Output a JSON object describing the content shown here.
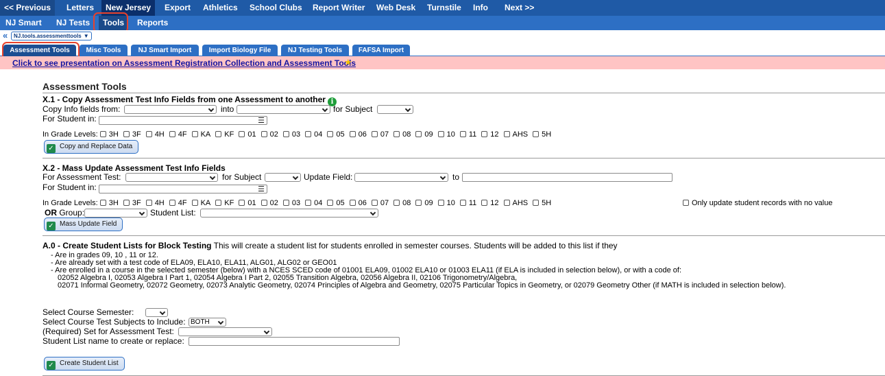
{
  "top_nav": {
    "items": [
      "<< Previous",
      "Letters",
      "New Jersey",
      "Export",
      "Athletics",
      "School Clubs",
      "Report Writer",
      "Web Desk",
      "Turnstile",
      "Info",
      "Next >>"
    ]
  },
  "sub_nav": {
    "items": [
      "NJ Smart",
      "NJ Tests",
      "Tools",
      "Reports"
    ]
  },
  "breadcrumb": {
    "value": "NJ.tools.assessmenttools"
  },
  "tabs": [
    "Assessment Tools",
    "Misc Tools",
    "NJ Smart Import",
    "Import Biology File",
    "NJ Testing Tools",
    "FAFSA Import"
  ],
  "banner": {
    "link_text": "Click to see presentation on Assessment Registration Collection and Assessment Tools"
  },
  "page": {
    "title": "Assessment Tools"
  },
  "grade_levels": [
    "3H",
    "3F",
    "4H",
    "4F",
    "KA",
    "KF",
    "01",
    "02",
    "03",
    "04",
    "05",
    "06",
    "07",
    "08",
    "09",
    "10",
    "11",
    "12",
    "AHS",
    "5H"
  ],
  "x1": {
    "title": "X.1 - Copy Assessment Test Info Fields from one Assessment to another",
    "copy_from_label": "Copy Info fields from:",
    "into_label": "into",
    "subject_label": "for Subject",
    "student_in_label": "For Student in:",
    "grade_levels_label": "In Grade Levels:",
    "button": "Copy and Replace Data"
  },
  "x2": {
    "title": "X.2 - Mass Update Assessment Test Info Fields",
    "test_label": "For Assessment Test:",
    "subject_label": "for Subject",
    "update_field_label": "Update Field:",
    "to_label": "to",
    "student_in_label": "For Student in:",
    "grade_levels_label": "In Grade Levels:",
    "no_value_label": "Only update student records with no value",
    "or_label": "OR",
    "group_label": "Group:",
    "student_list_label": "Student List:",
    "button": "Mass Update Field"
  },
  "a0": {
    "title": "A.0 - Create Student Lists for Block Testing",
    "description": "This will create a student list for students enrolled in semester courses. Students will be added to this list if they",
    "lines": [
      "- Are in grades 09, 10 , 11 or 12.",
      "- Are already set with a test code of ELA09, ELA10, ELA11, ALG01, ALG02 or GEO01",
      "- Are enrolled in a course in the selected semester (below) with a NCES SCED code of 01001 ELA09, 01002 ELA10 or 01003 ELA11 (if ELA is included in selection below), or with a code of:",
      "02052 Algebra I, 02053 Algebra I Part 1, 02054 Algebra I Part 2, 02055 Transition Algebra, 02056 Algebra II, 02106 Trigonometry/Algebra,",
      "02071 Informal Geometry, 02072 Geometry, 02073 Analytic Geometry, 02074 Principles of Algebra and Geometry, 02075 Particular Topics in Geometry, or 02079 Geometry Other (if MATH is included in selection below)."
    ],
    "semester_label": "Select Course Semester:",
    "subjects_label": "Select Course Test Subjects to Include:",
    "subjects_value": "BOTH",
    "assessment_label": "(Required) Set for Assessment Test:",
    "list_name_label": "Student List name to create or replace:",
    "button": "Create Student List"
  }
}
